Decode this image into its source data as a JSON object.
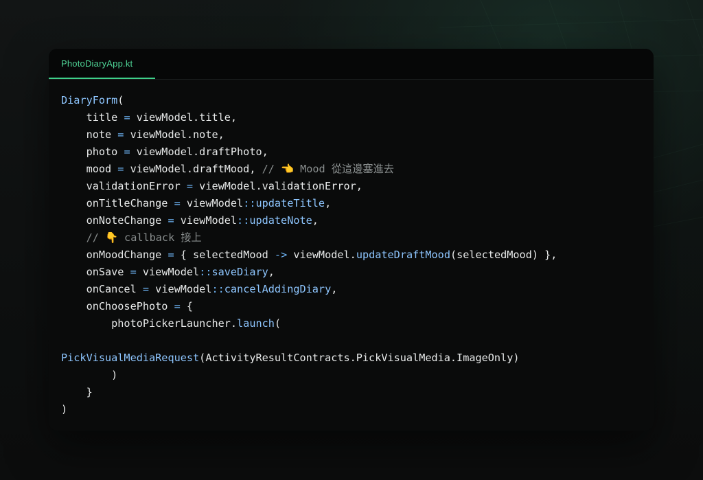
{
  "editor": {
    "tab_label": "PhotoDiaryApp.kt",
    "lines": [
      [
        {
          "t": "DiaryForm",
          "c": "fn"
        },
        {
          "t": "(",
          "c": "plain"
        }
      ],
      [
        {
          "t": "    title ",
          "c": "plain"
        },
        {
          "t": "=",
          "c": "op"
        },
        {
          "t": " viewModel.title,",
          "c": "plain"
        }
      ],
      [
        {
          "t": "    note ",
          "c": "plain"
        },
        {
          "t": "=",
          "c": "op"
        },
        {
          "t": " viewModel.note,",
          "c": "plain"
        }
      ],
      [
        {
          "t": "    photo ",
          "c": "plain"
        },
        {
          "t": "=",
          "c": "op"
        },
        {
          "t": " viewModel.draftPhoto,",
          "c": "plain"
        }
      ],
      [
        {
          "t": "    mood ",
          "c": "plain"
        },
        {
          "t": "=",
          "c": "op"
        },
        {
          "t": " viewModel.draftMood, ",
          "c": "plain"
        },
        {
          "t": "// 👈 Mood 從這邊塞進去",
          "c": "comment"
        }
      ],
      [
        {
          "t": "    validationError ",
          "c": "plain"
        },
        {
          "t": "=",
          "c": "op"
        },
        {
          "t": " viewModel.validationError,",
          "c": "plain"
        }
      ],
      [
        {
          "t": "    onTitleChange ",
          "c": "plain"
        },
        {
          "t": "=",
          "c": "op"
        },
        {
          "t": " viewModel",
          "c": "plain"
        },
        {
          "t": "::",
          "c": "op"
        },
        {
          "t": "updateTitle",
          "c": "fn"
        },
        {
          "t": ",",
          "c": "plain"
        }
      ],
      [
        {
          "t": "    onNoteChange ",
          "c": "plain"
        },
        {
          "t": "=",
          "c": "op"
        },
        {
          "t": " viewModel",
          "c": "plain"
        },
        {
          "t": "::",
          "c": "op"
        },
        {
          "t": "updateNote",
          "c": "fn"
        },
        {
          "t": ",",
          "c": "plain"
        }
      ],
      [
        {
          "t": "    // 👇 callback 接上",
          "c": "comment"
        }
      ],
      [
        {
          "t": "    onMoodChange ",
          "c": "plain"
        },
        {
          "t": "=",
          "c": "op"
        },
        {
          "t": " { selectedMood ",
          "c": "plain"
        },
        {
          "t": "->",
          "c": "op"
        },
        {
          "t": " viewModel.",
          "c": "plain"
        },
        {
          "t": "updateDraftMood",
          "c": "fn"
        },
        {
          "t": "(selectedMood) },",
          "c": "plain"
        }
      ],
      [
        {
          "t": "    onSave ",
          "c": "plain"
        },
        {
          "t": "=",
          "c": "op"
        },
        {
          "t": " viewModel",
          "c": "plain"
        },
        {
          "t": "::",
          "c": "op"
        },
        {
          "t": "saveDiary",
          "c": "fn"
        },
        {
          "t": ",",
          "c": "plain"
        }
      ],
      [
        {
          "t": "    onCancel ",
          "c": "plain"
        },
        {
          "t": "=",
          "c": "op"
        },
        {
          "t": " viewModel",
          "c": "plain"
        },
        {
          "t": "::",
          "c": "op"
        },
        {
          "t": "cancelAddingDiary",
          "c": "fn"
        },
        {
          "t": ",",
          "c": "plain"
        }
      ],
      [
        {
          "t": "    onChoosePhoto ",
          "c": "plain"
        },
        {
          "t": "=",
          "c": "op"
        },
        {
          "t": " {",
          "c": "plain"
        }
      ],
      [
        {
          "t": "        photoPickerLauncher.",
          "c": "plain"
        },
        {
          "t": "launch",
          "c": "fn"
        },
        {
          "t": "(",
          "c": "plain"
        }
      ],
      [],
      [
        {
          "t": "PickVisualMediaRequest",
          "c": "fn"
        },
        {
          "t": "(ActivityResultContracts.PickVisualMedia.ImageOnly)",
          "c": "plain"
        }
      ],
      [
        {
          "t": "        )",
          "c": "plain"
        }
      ],
      [
        {
          "t": "    }",
          "c": "plain"
        }
      ],
      [
        {
          "t": ")",
          "c": "plain"
        }
      ]
    ]
  },
  "colors": {
    "tab_accent": "#3fd08a",
    "function": "#8ec6ff",
    "operator": "#6fb6f7",
    "comment": "#8a8f8f",
    "text": "#e8eaea"
  }
}
